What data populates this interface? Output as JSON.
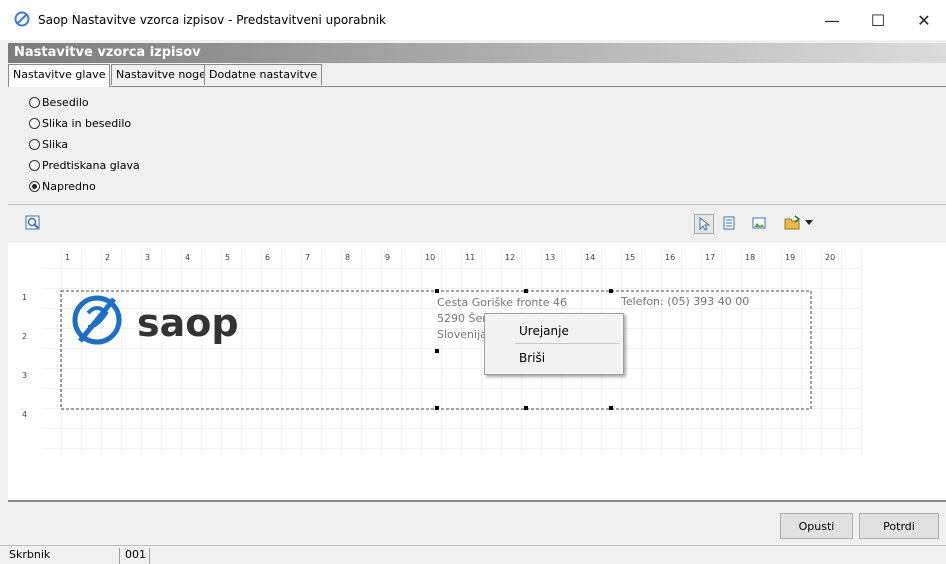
{
  "window": {
    "title": "Saop Nastavitve vzorca izpisov - Predstavitveni uporabnik",
    "minimize": "—",
    "maximize": "☐",
    "close": "✕"
  },
  "header": {
    "title": "Nastavitve vzorca izpisov"
  },
  "tabs": [
    {
      "label": "Nastavitve glave",
      "active": true
    },
    {
      "label": "Nastavitve noge",
      "active": false
    },
    {
      "label": "Dodatne nastavitve",
      "active": false
    }
  ],
  "radio_options": [
    {
      "label": "Besedilo",
      "checked": false
    },
    {
      "label": "Slika in besedilo",
      "checked": false
    },
    {
      "label": "Slika",
      "checked": false
    },
    {
      "label": "Predtiskana glava",
      "checked": false
    },
    {
      "label": "Napredno",
      "checked": true
    }
  ],
  "toolbar": {
    "left_icon": "zoom-icon",
    "right_icons": [
      "pointer-icon",
      "text-field-icon",
      "image-icon",
      "open-folder-icon",
      "dropdown-arrow-icon"
    ]
  },
  "ruler": {
    "numbers": [
      "1",
      "2",
      "3",
      "4",
      "5",
      "6",
      "7",
      "8",
      "9",
      "10",
      "11",
      "12",
      "13",
      "14",
      "15",
      "16",
      "17",
      "18",
      "19",
      "20"
    ],
    "side_numbers": [
      "1",
      "2",
      "3",
      "4"
    ]
  },
  "canvas": {
    "logo_text": "saop",
    "address_line1": "Cesta Goriške fronte 46",
    "address_line2": "5290 Šem",
    "address_line3": "Slovenija",
    "phone": "Telefon: (05) 393 40 00"
  },
  "context_menu": {
    "items": [
      "Urejanje",
      "Briši"
    ]
  },
  "buttons": {
    "cancel": "Opusti",
    "ok": "Potrdi"
  },
  "status": {
    "user": "Skrbnik",
    "code": "001"
  },
  "colors": {
    "brand_blue": "#1f6fc2",
    "header_gradient_start": "#7c7c7c"
  }
}
